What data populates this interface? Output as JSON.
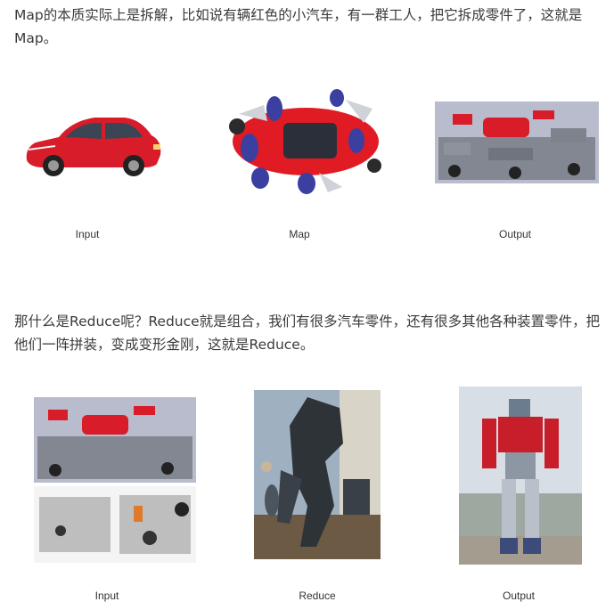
{
  "section_map": {
    "paragraph": "Map的本质实际上是拆解，比如说有辆红色的小汽车，有一群工人，把它拆成零件了，这就是Map。",
    "figures": [
      {
        "caption": "Input"
      },
      {
        "caption": "Map"
      },
      {
        "caption": "Output"
      }
    ]
  },
  "section_reduce": {
    "paragraph": "那什么是Reduce呢？Reduce就是组合，我们有很多汽车零件，还有很多其他各种装置零件，把他们一阵拼装，变成变形金刚，这就是Reduce。",
    "figures": [
      {
        "caption": "Input"
      },
      {
        "caption": "Reduce"
      },
      {
        "caption": "Output"
      }
    ]
  },
  "colors": {
    "text": "#3a3a3a",
    "car_red": "#d81c2a",
    "parts_bg": "#b9bccd"
  }
}
